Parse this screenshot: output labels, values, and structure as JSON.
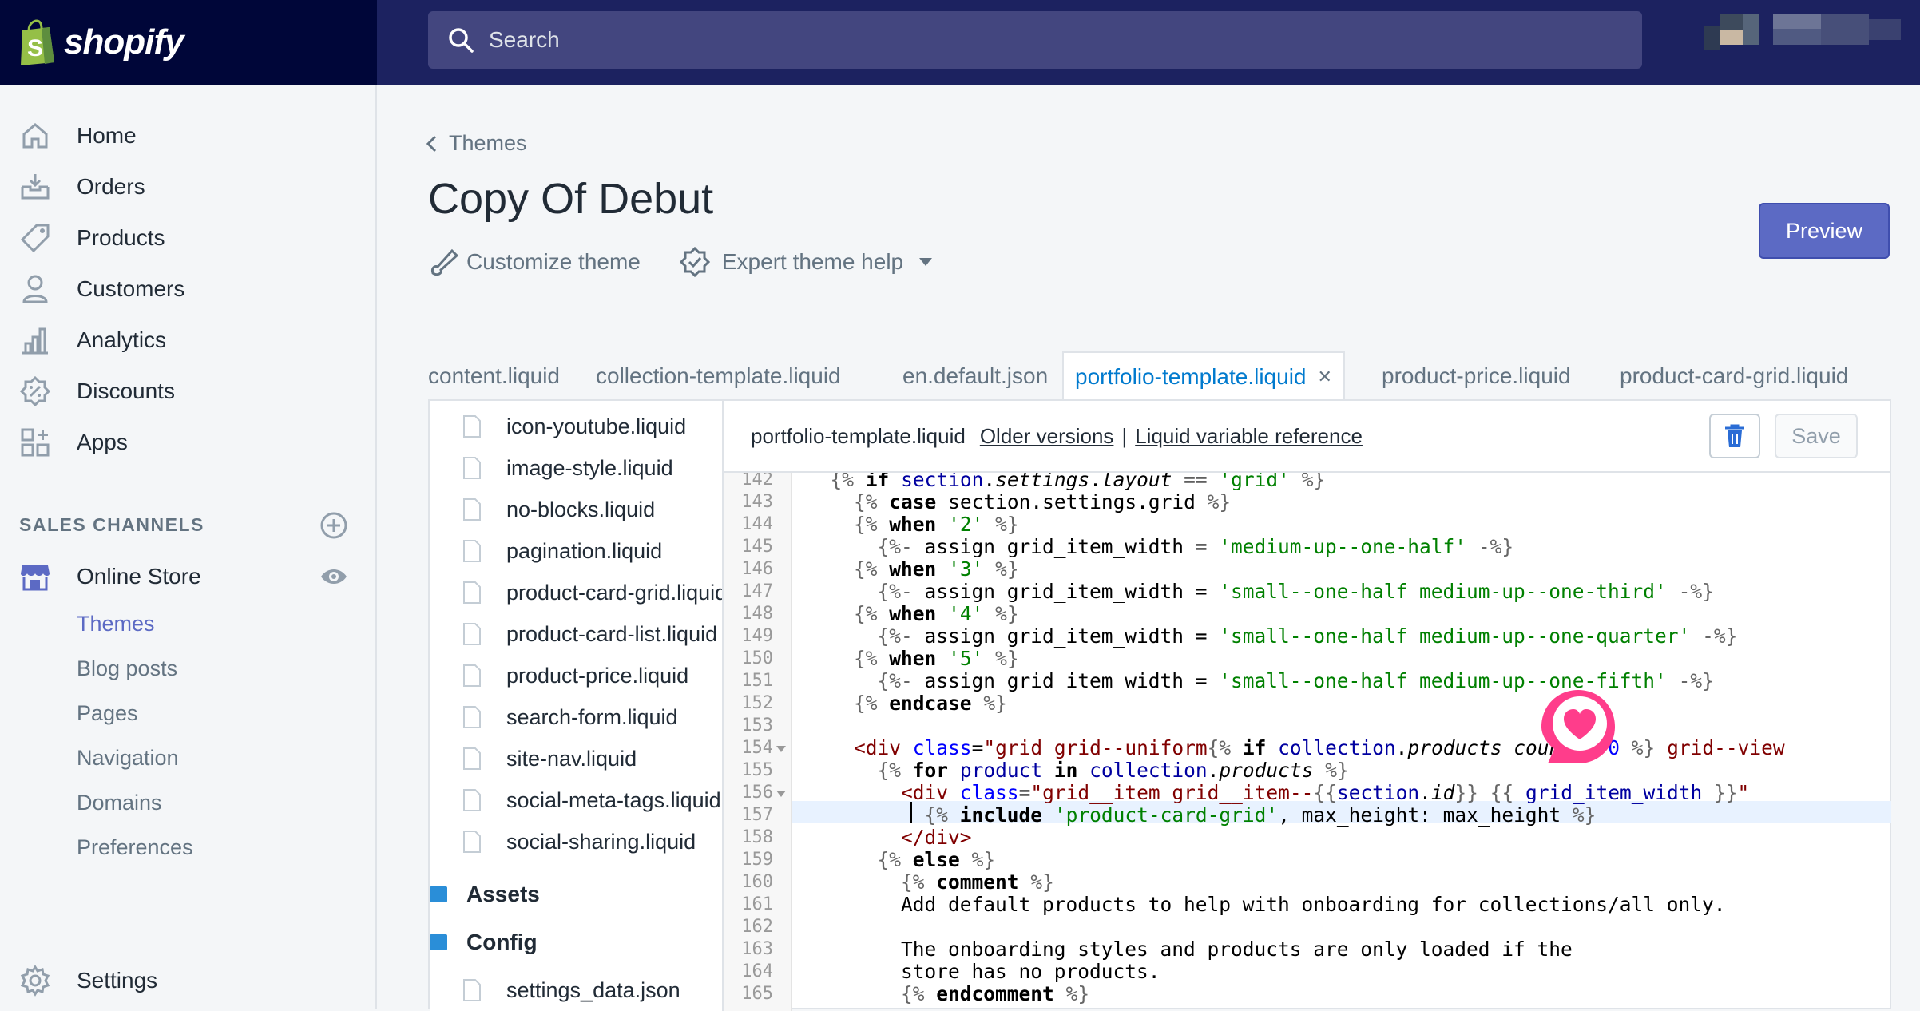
{
  "brand": {
    "name": "shopify"
  },
  "search": {
    "placeholder": "Search"
  },
  "sidebar": {
    "items": [
      {
        "label": "Home",
        "icon": "home-icon"
      },
      {
        "label": "Orders",
        "icon": "orders-icon"
      },
      {
        "label": "Products",
        "icon": "tag-icon"
      },
      {
        "label": "Customers",
        "icon": "person-icon"
      },
      {
        "label": "Analytics",
        "icon": "bar-chart-icon"
      },
      {
        "label": "Discounts",
        "icon": "discount-icon"
      },
      {
        "label": "Apps",
        "icon": "apps-icon"
      }
    ],
    "sales_channels_title": "SALES CHANNELS",
    "online_store": "Online Store",
    "sub_items": [
      "Themes",
      "Blog posts",
      "Pages",
      "Navigation",
      "Domains",
      "Preferences"
    ],
    "settings": "Settings"
  },
  "header": {
    "back_label": "Themes",
    "title": "Copy Of Debut",
    "customize_label": "Customize theme",
    "expert_label": "Expert theme help",
    "preview_label": "Preview"
  },
  "tabs": [
    "content.liquid",
    "collection-template.liquid",
    "en.default.json",
    "portfolio-template.liquid",
    "product-price.liquid",
    "product-card-grid.liquid"
  ],
  "active_tab": "portfolio-template.liquid",
  "tab_close_glyph": "✕",
  "filetree": {
    "files": [
      "icon-youtube.liquid",
      "image-style.liquid",
      "no-blocks.liquid",
      "pagination.liquid",
      "product-card-grid.liquid",
      "product-card-list.liquid",
      "product-price.liquid",
      "search-form.liquid",
      "site-nav.liquid",
      "social-meta-tags.liquid",
      "social-sharing.liquid"
    ],
    "folders": [
      "Assets",
      "Config"
    ],
    "config_files": [
      "settings_data.json"
    ]
  },
  "editor": {
    "filename": "portfolio-template.liquid",
    "older_versions": "Older versions",
    "separator": "|",
    "liquid_reference": "Liquid variable reference",
    "save_label": "Save",
    "line_numbers": [
      "142",
      "143",
      "144",
      "145",
      "146",
      "147",
      "148",
      "149",
      "150",
      "151",
      "152",
      "153",
      "154",
      "155",
      "156",
      "157",
      "158",
      "159",
      "160",
      "161",
      "162",
      "163",
      "164",
      "165"
    ],
    "comment_line_1": "Add default products to help with onboarding for collections/all only.",
    "comment_line_2": "The onboarding styles and products are only loaded if the",
    "comment_line_3": "store has no products."
  },
  "colors": {
    "topbar": "#1c2260",
    "brand_bg": "#000639",
    "accent": "#5c6ac4",
    "link_blue": "#007ace",
    "badge_pink": "#ff3d8b"
  }
}
